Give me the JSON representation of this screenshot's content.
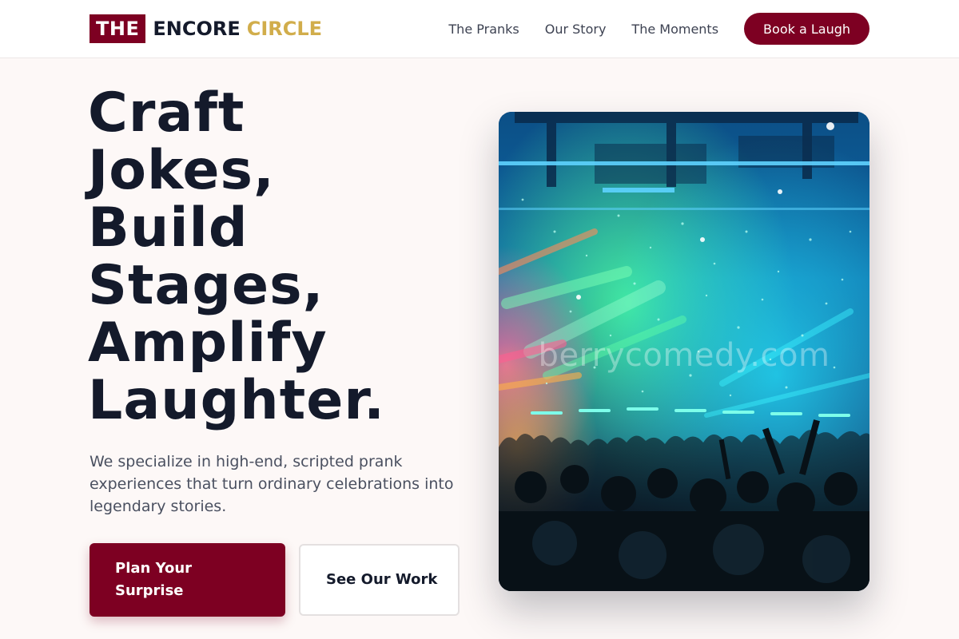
{
  "header": {
    "logo": {
      "part1": "THE",
      "part2": "ENCORE",
      "part3": "CIRCLE"
    },
    "nav": [
      {
        "label": "The Pranks"
      },
      {
        "label": "Our Story"
      },
      {
        "label": "The Moments"
      }
    ],
    "cta_label": "Book a Laugh"
  },
  "hero": {
    "title_lines": [
      "Craft",
      "Jokes,",
      "Build",
      "Stages,",
      "Amplify",
      "Laughter."
    ],
    "description": "We specialize in high-end, scripted prank experiences that turn ordinary celebrations into legendary stories.",
    "primary_button": "Plan Your Surprise",
    "secondary_button": "See Our Work",
    "image": {
      "subject": "concert crowd under colorful stage lights and confetti",
      "watermark": "berrycomedy.com"
    }
  },
  "colors": {
    "brand": "#7d0022",
    "gold": "#d1ad4b",
    "ink": "#141a2b",
    "background": "#fdf8f7"
  }
}
